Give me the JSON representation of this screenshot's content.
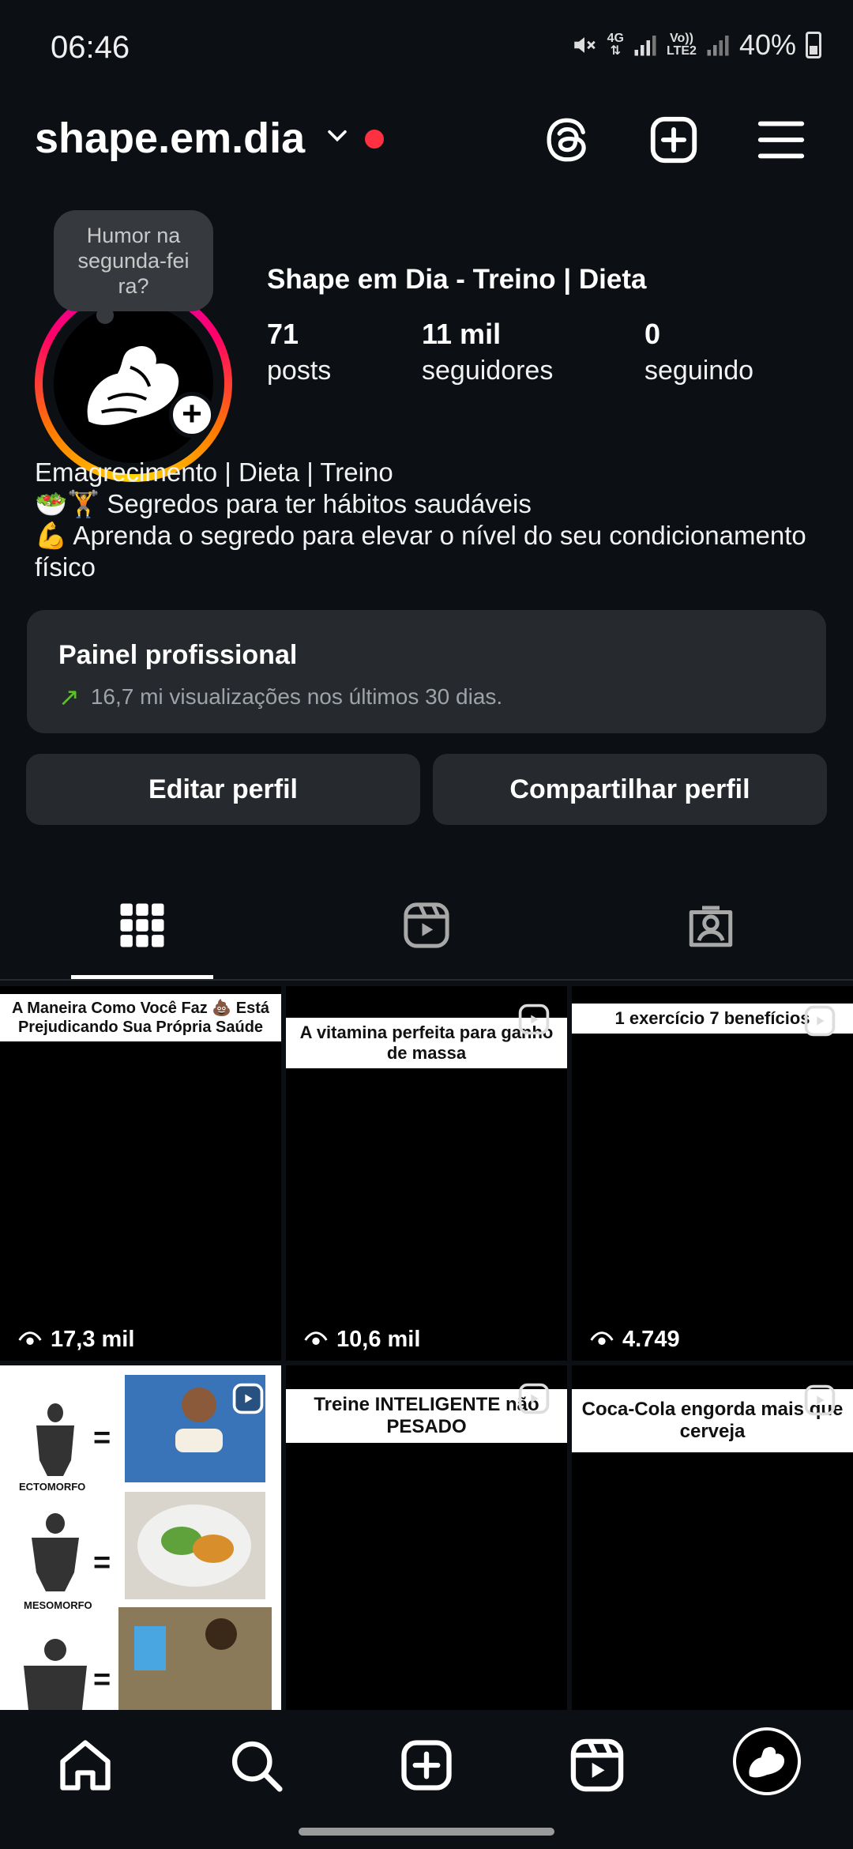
{
  "status_bar": {
    "time": "06:46",
    "network_top": "4G",
    "lte_top": "Vo))",
    "lte_bottom": "LTE2",
    "battery": "40%"
  },
  "header": {
    "username": "shape.em.dia"
  },
  "profile": {
    "note": "Humor na segunda-fei ra?",
    "display_name": "Shape em Dia - Treino | Dieta",
    "stats": [
      {
        "num": "71",
        "label": "posts"
      },
      {
        "num": "11 mil",
        "label": "seguidores"
      },
      {
        "num": "0",
        "label": "seguindo"
      }
    ],
    "bio_line1": "Emagrecimento | Dieta | Treino",
    "bio_line2": "🥗🏋️ Segredos para ter hábitos saudáveis",
    "bio_line3": "💪 Aprenda o segredo para elevar o nível do seu condicionamento físico"
  },
  "panel": {
    "title": "Painel profissional",
    "subtitle": "16,7 mi visualizações nos últimos 30 dias."
  },
  "buttons": {
    "edit": "Editar perfil",
    "share": "Compartilhar perfil"
  },
  "grid": [
    {
      "caption": "A Maneira Como Você Faz 💩 Está Prejudicando Sua Própria Saúde",
      "views": "17,3 mil"
    },
    {
      "caption": "A vitamina perfeita para ganho de massa",
      "views": "10,6 mil"
    },
    {
      "caption": "1 exercício 7 benefícios",
      "views": "4.749"
    },
    {
      "caption": "",
      "views": ""
    },
    {
      "caption": "Treine INTELIGENTE não PESADO",
      "views": ""
    },
    {
      "caption": "Coca-Cola engorda mais que cerveja",
      "views": ""
    }
  ],
  "post4_labels": [
    "ECTOMORFO",
    "MESOMORFO"
  ],
  "colors": {
    "background": "#0c1014",
    "notification_dot": "#ff3040",
    "trend_arrow": "#58c322"
  }
}
